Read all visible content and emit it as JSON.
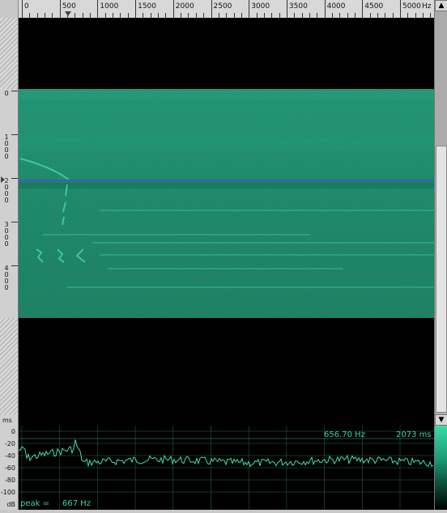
{
  "top_ruler": {
    "ticks": [
      "0",
      "500",
      "1000",
      "1500",
      "2000",
      "2500",
      "3000",
      "3500",
      "4000",
      "4500",
      "5000"
    ],
    "unit": "Hz"
  },
  "left_ruler": {
    "labels": [
      "0",
      "1000",
      "2000",
      "3000",
      "4000"
    ],
    "unit": "ms"
  },
  "bottom_ruler": {
    "labels": [
      "0",
      "-20",
      "-40",
      "-60",
      "-80",
      "-100"
    ],
    "unit": "dB"
  },
  "readouts": {
    "frequency": "656.70 Hz",
    "time": "2073 ms",
    "peak_prefix": "peak =",
    "peak_value": "667 Hz"
  },
  "scrollbar": {
    "up": "▲",
    "down": "▼"
  },
  "colors": {
    "spectrogram": "#1a8767",
    "trace": "#3fe0b0",
    "cursor": "#4b50c8"
  }
}
